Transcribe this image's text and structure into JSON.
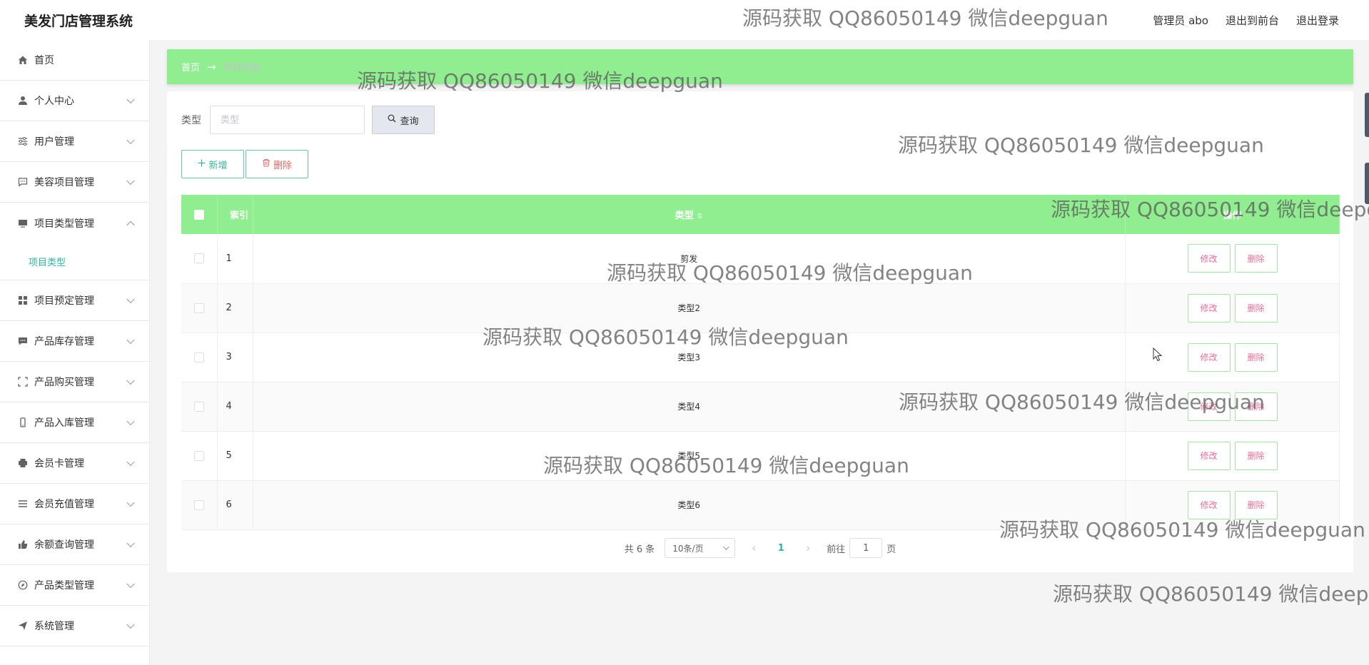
{
  "header": {
    "title": "美发门店管理系统",
    "admin_label": "管理员 abo",
    "to_front_label": "退出到前台",
    "logout_label": "退出登录"
  },
  "sidebar": {
    "items": [
      {
        "label": "首页",
        "icon": "home-icon",
        "expanded": false,
        "has_children": false
      },
      {
        "label": "个人中心",
        "icon": "user-icon",
        "has_children": true
      },
      {
        "label": "用户管理",
        "icon": "sliders-icon",
        "has_children": true
      },
      {
        "label": "美容项目管理",
        "icon": "chat-icon",
        "has_children": true
      },
      {
        "label": "项目类型管理",
        "icon": "monitor-icon",
        "has_children": true,
        "expanded": true
      },
      {
        "label": "项目预定管理",
        "icon": "grid-icon",
        "has_children": true
      },
      {
        "label": "产品库存管理",
        "icon": "message-icon",
        "has_children": true
      },
      {
        "label": "产品购买管理",
        "icon": "frame-icon",
        "has_children": true
      },
      {
        "label": "产品入库管理",
        "icon": "phone-icon",
        "has_children": true
      },
      {
        "label": "会员卡管理",
        "icon": "printer-icon",
        "has_children": true
      },
      {
        "label": "会员充值管理",
        "icon": "menu-icon",
        "has_children": true
      },
      {
        "label": "余额查询管理",
        "icon": "thumb-icon",
        "has_children": true
      },
      {
        "label": "产品类型管理",
        "icon": "compass-icon",
        "has_children": true
      },
      {
        "label": "系统管理",
        "icon": "send-icon",
        "has_children": true
      }
    ],
    "submenu": {
      "label": "项目类型"
    }
  },
  "breadcrumb": {
    "home": "首页",
    "arrow": "→",
    "current": "项目类型"
  },
  "search": {
    "label": "类型",
    "placeholder": "类型",
    "query_label": "查询"
  },
  "actions": {
    "add_label": "新增",
    "delete_label": "删除"
  },
  "table": {
    "headers": {
      "index": "索引",
      "type": "类型",
      "ops": "操作"
    },
    "edit_label": "修改",
    "delete_label": "删除",
    "rows": [
      {
        "index": "1",
        "type": "剪发"
      },
      {
        "index": "2",
        "type": "类型2"
      },
      {
        "index": "3",
        "type": "类型3"
      },
      {
        "index": "4",
        "type": "类型4"
      },
      {
        "index": "5",
        "type": "类型5"
      },
      {
        "index": "6",
        "type": "类型6"
      }
    ]
  },
  "pagination": {
    "total": "共 6 条",
    "page_size": "10条/页",
    "current_page": "1",
    "goto_prefix": "前往",
    "goto_value": "1",
    "goto_suffix": "页"
  },
  "watermark": {
    "text": "源码获取 QQ86050149 微信deepguan"
  },
  "colors": {
    "accent_green": "#90ee90",
    "teal": "#2fb3a4",
    "danger": "#e26b6b"
  }
}
